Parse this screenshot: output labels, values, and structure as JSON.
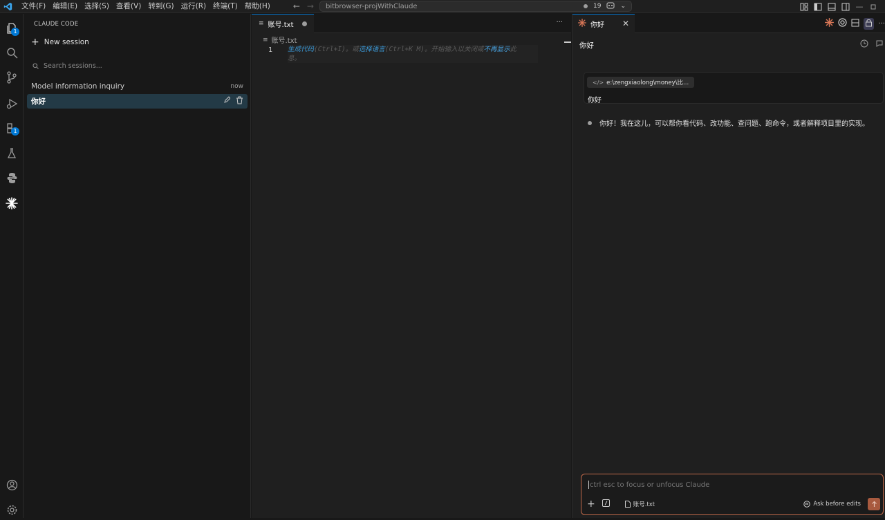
{
  "menu": [
    "文件(F)",
    "编辑(E)",
    "选择(S)",
    "查看(V)",
    "转到(G)",
    "运行(R)",
    "终端(T)",
    "帮助(H)"
  ],
  "command_center": {
    "text": "bitbrowser-projWithClaude",
    "count": "19"
  },
  "activity": {
    "explorer_badge": "1",
    "extensions_badge": "1"
  },
  "sidebar": {
    "title": "CLAUDE CODE",
    "new_session": "New session",
    "search_placeholder": "Search sessions...",
    "sessions": [
      {
        "title": "Model information inquiry",
        "time": "now"
      },
      {
        "title": "你好",
        "time": ""
      }
    ]
  },
  "editor": {
    "tab_label": "账号.txt",
    "breadcrumb": "账号.txt",
    "line_number": "1",
    "hint": {
      "part1": "生成代码",
      "part2": "(Ctrl+I)。或",
      "part3": "选择语言",
      "part4": "(Ctrl+K M)。开始输入以关闭或",
      "part5": "不再显示",
      "part6": "此",
      "part7": "息。"
    }
  },
  "claude": {
    "tab_label": "你好",
    "conversation_title": "你好",
    "file_chip": "e:\\zengxiaolong\\money\\比...",
    "user_message": "你好",
    "assistant_message": "你好！我在这儿，可以帮你看代码、改功能、查问题、跑命令，或者解释项目里的实现。",
    "input_placeholder": "ctrl esc to focus or unfocus Claude",
    "input_file": "账号.txt",
    "mode": "Ask before edits",
    "accent": "#d97757"
  }
}
